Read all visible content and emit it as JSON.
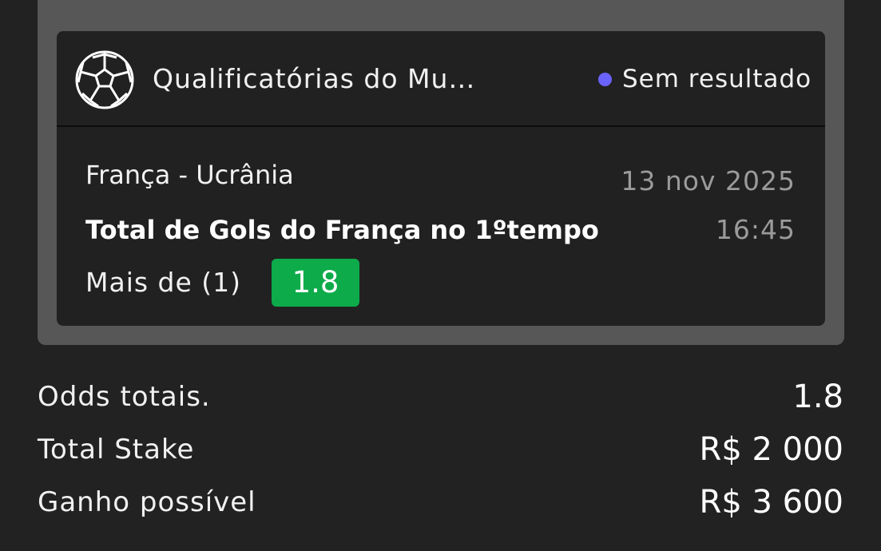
{
  "bet": {
    "league": "Qualificatórias do Mundial de…",
    "status": "Sem resultado",
    "match": "França - Ucrânia",
    "date": "13 nov 2025",
    "market": "Total de Gols do França no 1ºtempo",
    "time": "16:45",
    "selection": "Mais de (1)",
    "odds": "1.8",
    "icon": "soccer-ball-icon",
    "status_color": "#6b63ff",
    "odds_color": "#0dab4a"
  },
  "summary": {
    "odds_label": "Odds totais.",
    "odds_value": "1.8",
    "stake_label": "Total Stake",
    "stake_value": "R$ 2 000",
    "win_label": "Ganho possível",
    "win_value": "R$ 3 600"
  }
}
